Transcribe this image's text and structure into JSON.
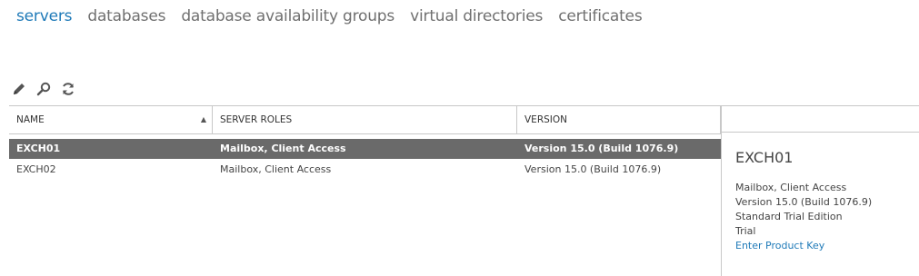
{
  "tabs": [
    "servers",
    "databases",
    "database availability groups",
    "virtual directories",
    "certificates"
  ],
  "toolbar": {
    "edit_icon": "pencil-icon",
    "search_icon": "search-icon",
    "refresh_icon": "refresh-icon"
  },
  "grid": {
    "columns": {
      "name": "NAME",
      "roles": "SERVER ROLES",
      "version": "VERSION"
    },
    "sort_indicator": "▲",
    "rows": [
      {
        "name": "EXCH01",
        "roles": "Mailbox, Client Access",
        "version": "Version 15.0 (Build 1076.9)"
      },
      {
        "name": "EXCH02",
        "roles": "Mailbox, Client Access",
        "version": "Version 15.0 (Build 1076.9)"
      }
    ]
  },
  "details": {
    "title": "EXCH01",
    "roles": "Mailbox, Client Access",
    "version": "Version 15.0 (Build 1076.9)",
    "edition": "Standard Trial Edition",
    "license": "Trial",
    "product_key_link": "Enter Product Key"
  },
  "colors": {
    "accent": "#1f7ab8",
    "selected_row": "#6a6a6a",
    "border": "#c8c8c8"
  }
}
